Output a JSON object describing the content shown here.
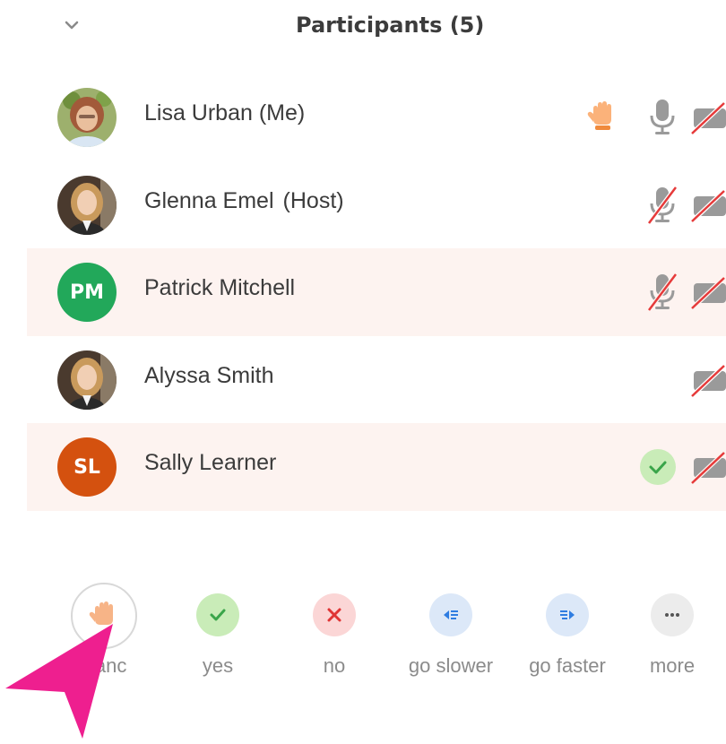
{
  "header": {
    "title": "Participants (5)",
    "collapse_icon": "chevron-down-icon"
  },
  "participants": [
    {
      "name": "Lisa Urban (Me)",
      "role": "",
      "avatar": "photo",
      "highlighted": false,
      "status_icons": [
        "raised-hand-icon",
        "microphone-icon",
        "video-off-icon"
      ]
    },
    {
      "name": "Glenna Emel",
      "role": "(Host)",
      "avatar": "photo",
      "highlighted": false,
      "status_icons": [
        "microphone-muted-icon",
        "video-off-icon"
      ]
    },
    {
      "name": "Patrick Mitchell",
      "role": "",
      "avatar": "initials",
      "initials": "PM",
      "avatar_color": "#22a85a",
      "highlighted": true,
      "status_icons": [
        "microphone-muted-icon",
        "video-off-icon"
      ]
    },
    {
      "name": "Alyssa Smith",
      "role": "",
      "avatar": "photo",
      "highlighted": false,
      "status_icons": [
        "video-off-icon"
      ]
    },
    {
      "name": "Sally Learner",
      "role": "",
      "avatar": "initials",
      "initials": "SL",
      "avatar_color": "#d4510f",
      "highlighted": true,
      "status_icons": [
        "yes-check-icon",
        "video-off-icon"
      ]
    }
  ],
  "reactions": [
    {
      "label": "Hanc",
      "icon": "raise-hand-icon",
      "color": "#f7b487"
    },
    {
      "label": "yes",
      "icon": "check-icon",
      "color": "#c9ecb8"
    },
    {
      "label": "no",
      "icon": "x-icon",
      "color": "#fbd6d6"
    },
    {
      "label": "go slower",
      "icon": "go-slower-icon",
      "color": "#dce8f8"
    },
    {
      "label": "go faster",
      "icon": "go-faster-icon",
      "color": "#dce8f8"
    },
    {
      "label": "more",
      "icon": "more-icon",
      "color": "#ececec"
    }
  ],
  "colors": {
    "highlight_row": "#fdf3f0",
    "pointer_arrow": "#ee1f8f"
  }
}
